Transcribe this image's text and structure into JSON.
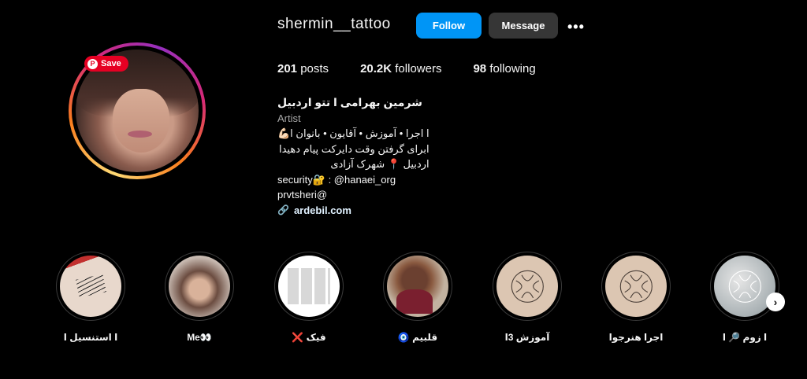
{
  "profile": {
    "username": "shermin__tattoo",
    "follow_label": "Follow",
    "message_label": "Message",
    "more_label": "•••",
    "save_label": "Save"
  },
  "stats": {
    "posts_count": "201",
    "posts_label": "posts",
    "followers_count": "20.2K",
    "followers_label": "followers",
    "following_count": "98",
    "following_label": "following"
  },
  "bio": {
    "name": "شرمین بهرامی ا تتو اردبیل",
    "category": "Artist",
    "line1": "ا اجرا • آموزش • آقایون • بانوان ا💪🏻",
    "line2": "ابرای گرفتن وقت دایرکت پیام دهیدا",
    "line3": "اردبیل 📍 شهرک آزادی",
    "line4": "security🔐 : @hanaei_org",
    "line5": "prvtsheri@",
    "link": "ardebil.com"
  },
  "highlights": [
    {
      "label": "ا استنسیل ا",
      "icon": "tattoo-arm"
    },
    {
      "label": "Me👀",
      "icon": "selfie"
    },
    {
      "label": "فیک ❌",
      "icon": "screenshot-grid"
    },
    {
      "label": "قلبیم 🧿",
      "icon": "baby-photo"
    },
    {
      "label": "آموزش 3ا",
      "icon": "logo"
    },
    {
      "label": "اجرا هنرجوا",
      "icon": "logo"
    },
    {
      "label": "ا زوم 🔎 ا",
      "icon": "marble-logo"
    }
  ],
  "colors": {
    "follow": "#0095f6",
    "message": "#363636",
    "save": "#e60023",
    "background": "#000000"
  }
}
